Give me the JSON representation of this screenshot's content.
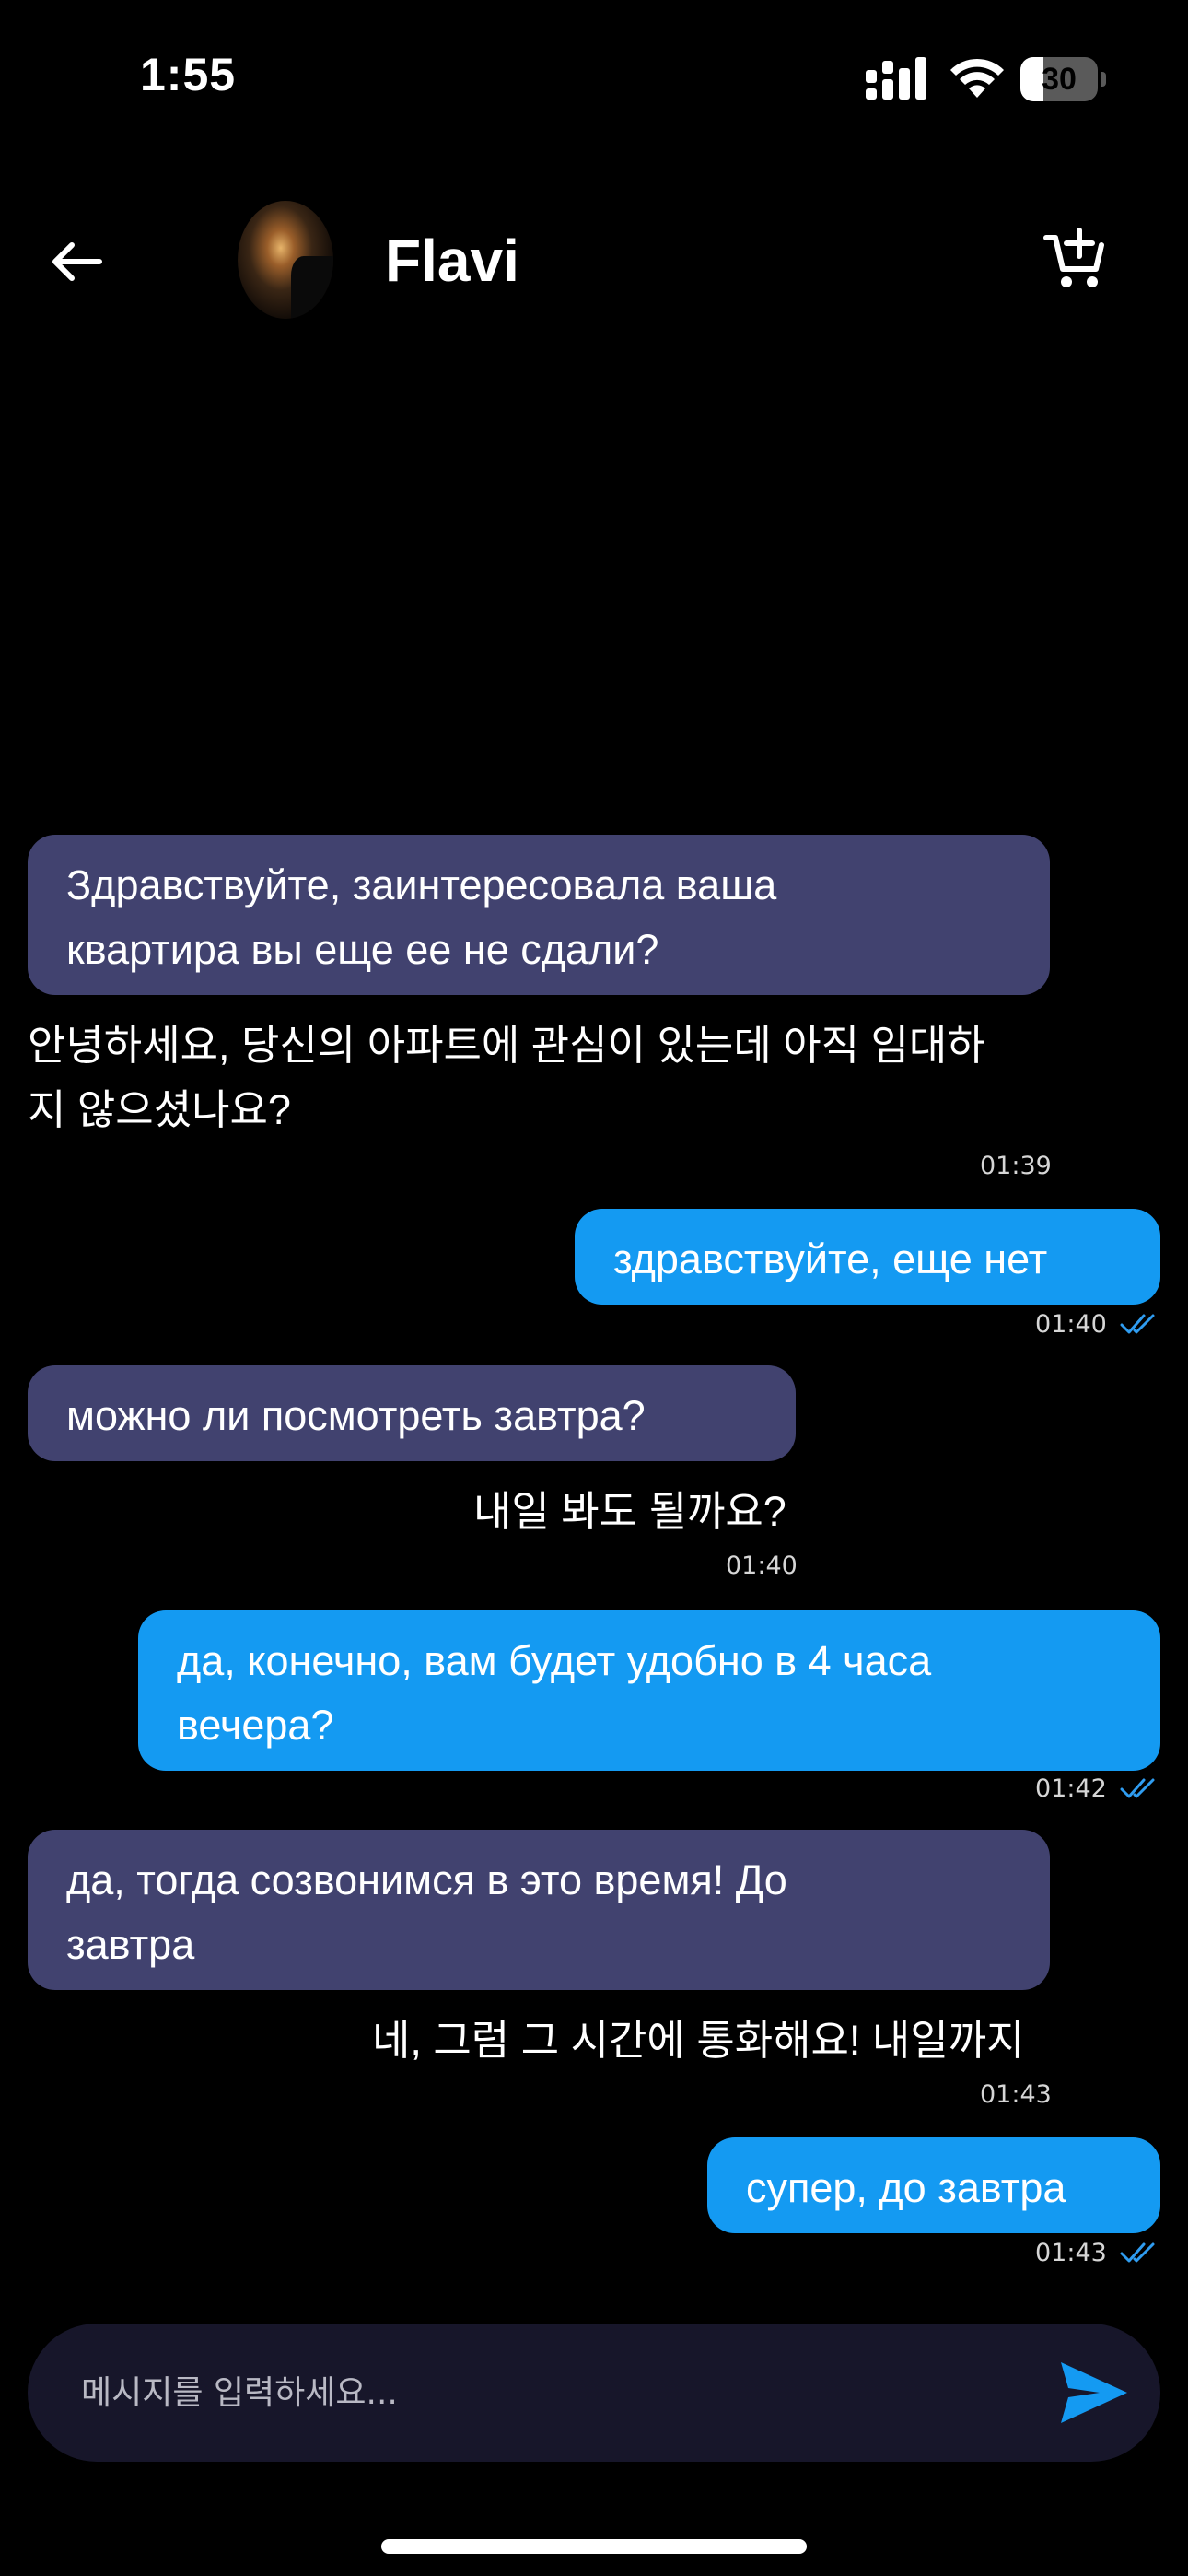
{
  "status_bar": {
    "time": "1:55",
    "battery_level": "30",
    "battery_fraction": 0.3
  },
  "header": {
    "contact_name": "Flavi",
    "back_icon": "arrow-left-icon",
    "cart_icon": "cart-add-icon"
  },
  "messages": [
    {
      "direction": "incoming",
      "text_line1": "Здравствуйте, заинтересовала ваша",
      "text_line2": "квартира вы еще ее не сдали?",
      "translation_line1": "안녕하세요, 당신의 아파트에 관심이 있는데 아직 임대하",
      "translation_line2": "지 않으셨나요?",
      "time": "01:39"
    },
    {
      "direction": "outgoing",
      "text": "здравствуйте, еще нет",
      "time": "01:40",
      "status": "read"
    },
    {
      "direction": "incoming",
      "text": "можно ли посмотреть завтра?",
      "translation": "내일 봐도 될까요?",
      "time": "01:40"
    },
    {
      "direction": "outgoing",
      "text_line1": "да, конечно, вам будет удобно в 4 часа",
      "text_line2": "вечера?",
      "time": "01:42",
      "status": "read"
    },
    {
      "direction": "incoming",
      "text_line1": "да, тогда созвонимся в это время! До",
      "text_line2": "завтра",
      "translation": "네, 그럼 그 시간에 통화해요! 내일까지",
      "time": "01:43"
    },
    {
      "direction": "outgoing",
      "text": "супер, до завтра",
      "time": "01:43",
      "status": "read"
    }
  ],
  "composer": {
    "placeholder": "메시지를 입력하세요...",
    "value": "",
    "send_icon": "send-icon"
  },
  "colors": {
    "background": "#000000",
    "incoming_bubble": "#41426f",
    "outgoing_bubble": "#149af2",
    "read_check": "#2f9cf0",
    "input_background": "#17162a"
  }
}
